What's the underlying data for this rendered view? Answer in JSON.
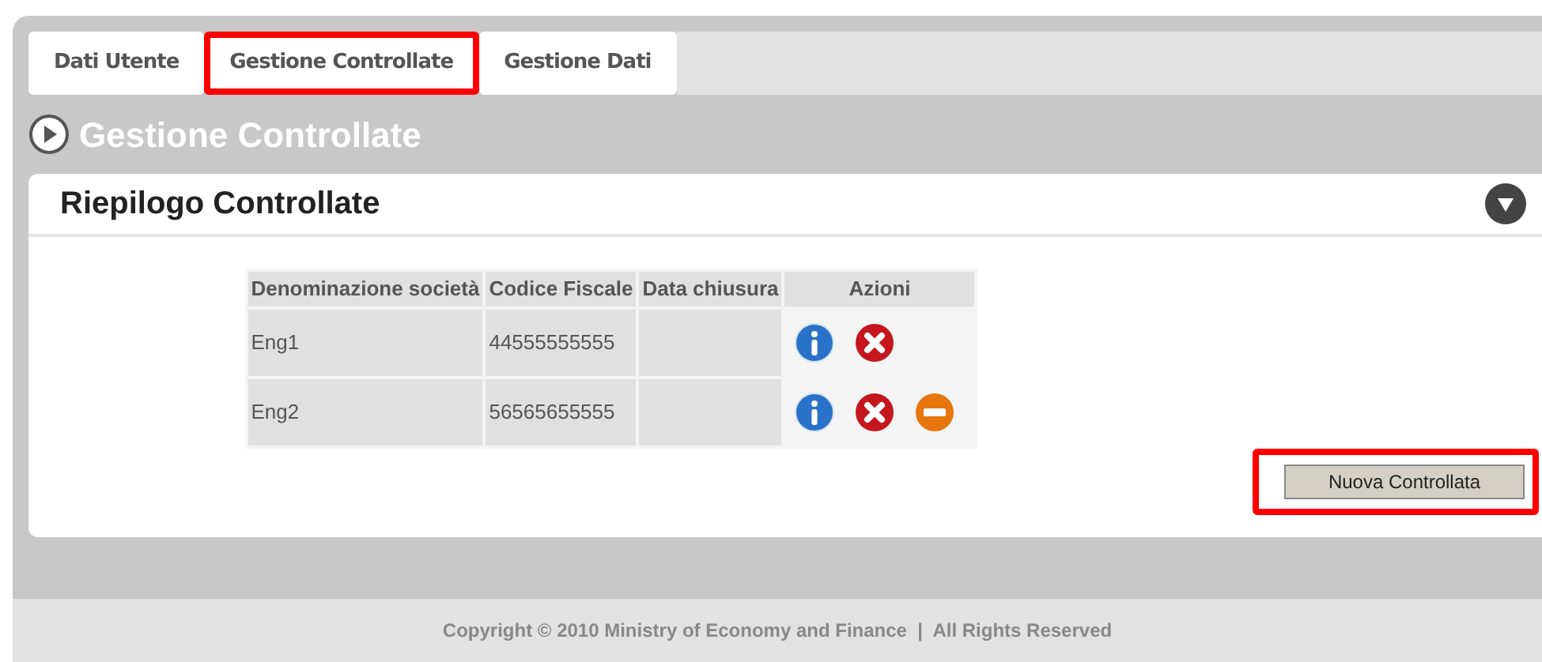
{
  "tabs": [
    {
      "label": "Dati Utente",
      "highlighted": false
    },
    {
      "label": "Gestione Controllate",
      "highlighted": true
    },
    {
      "label": "Gestione Dati",
      "highlighted": false
    }
  ],
  "page_title": "Gestione Controllate",
  "panel": {
    "title": "Riepilogo Controllate",
    "table": {
      "columns": [
        "Denominazione società",
        "Codice Fiscale",
        "Data chiusura",
        "Azioni"
      ],
      "rows": [
        {
          "name": "Eng1",
          "fiscal_code": "44555555555",
          "closing_date": "",
          "actions": [
            {
              "kind": "info"
            },
            {
              "kind": "delete"
            }
          ]
        },
        {
          "name": "Eng2",
          "fiscal_code": "56565655555",
          "closing_date": "",
          "actions": [
            {
              "kind": "info"
            },
            {
              "kind": "delete"
            },
            {
              "kind": "remove"
            }
          ]
        }
      ]
    },
    "button": {
      "label": "Nuova Controllata",
      "highlighted": true
    }
  },
  "footer": "Copyright © 2010 Ministry of Economy and Finance  |  All Rights Reserved"
}
